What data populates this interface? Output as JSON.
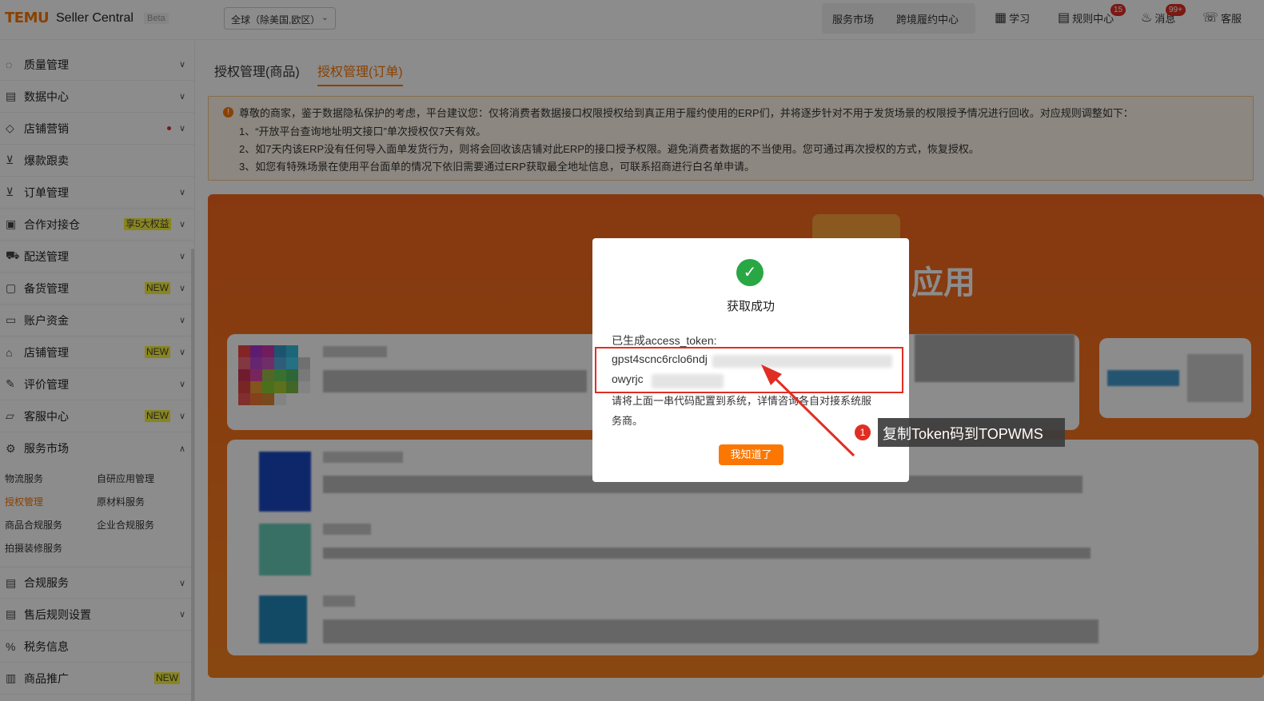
{
  "header": {
    "logo": "TEMU",
    "app_title": "Seller Central",
    "beta": "Beta",
    "region": "全球（除美国,欧区）",
    "nav_service_market": "服务市场",
    "nav_cross_border": "跨境履约中心",
    "learn": "学习",
    "rules_center": "规则中心",
    "rules_badge": "15",
    "messages": "消息",
    "messages_badge": "99+",
    "support": "客服"
  },
  "sidebar": {
    "items": [
      {
        "label": "质量管理"
      },
      {
        "label": "数据中心"
      },
      {
        "label": "店铺营销"
      },
      {
        "label": "爆款跟卖"
      },
      {
        "label": "订单管理"
      },
      {
        "label": "合作对接仓",
        "tag": "享5大权益"
      },
      {
        "label": "配送管理"
      },
      {
        "label": "备货管理",
        "tag": "NEW"
      },
      {
        "label": "账户资金"
      },
      {
        "label": "店铺管理",
        "tag": "NEW"
      },
      {
        "label": "评价管理"
      },
      {
        "label": "客服中心",
        "tag": "NEW"
      },
      {
        "label": "服务市场"
      }
    ],
    "sub_items": [
      "物流服务",
      "自研应用管理",
      "授权管理",
      "原材料服务",
      "商品合规服务",
      "企业合规服务",
      "拍摄装修服务"
    ],
    "bottom_items": [
      {
        "label": "合规服务"
      },
      {
        "label": "售后规则设置"
      },
      {
        "label": "税务信息"
      },
      {
        "label": "商品推广",
        "tag": "NEW"
      }
    ]
  },
  "tabs": [
    "授权管理(商品)",
    "授权管理(订单)"
  ],
  "notice": {
    "line1": "尊敬的商家，鉴于数据隐私保护的考虑，平台建议您：仅将消费者数据接口权限授权给到真正用于履约使用的ERP们，并将逐步针对不用于发货场景的权限授予情况进行回收。对应规则调整如下：",
    "line2": "1、“开放平台查询地址明文接口”单次授权仅7天有效。",
    "line3": "2、如7天内该ERP没有任何导入面单发货行为，则将会回收该店铺对此ERP的接口授予权限。避免消费者数据的不当使用。您可通过再次授权的方式，恢复授权。",
    "line4": "3、如您有特殊场景在使用平台面单的情况下依旧需要通过ERP获取最全地址信息，可联系招商进行白名单申请。"
  },
  "banner": {
    "title_fragment": "应用"
  },
  "modal": {
    "title": "获取成功",
    "generated_label": "已生成access_token:",
    "token_line1": "gpst4scnc6rclo6ndj",
    "token_line2": "owyrjc",
    "hint_line1": "请将上面一串代码配置到系统，详情咨询各自对接系统服",
    "hint_line2": "务商。",
    "ok_button": "我知道了"
  },
  "annotation": {
    "number": "1",
    "text": "复制Token码到TOPWMS"
  },
  "colors": {
    "accent": "#fb7701",
    "danger": "#e02e24",
    "success": "#29a745"
  }
}
